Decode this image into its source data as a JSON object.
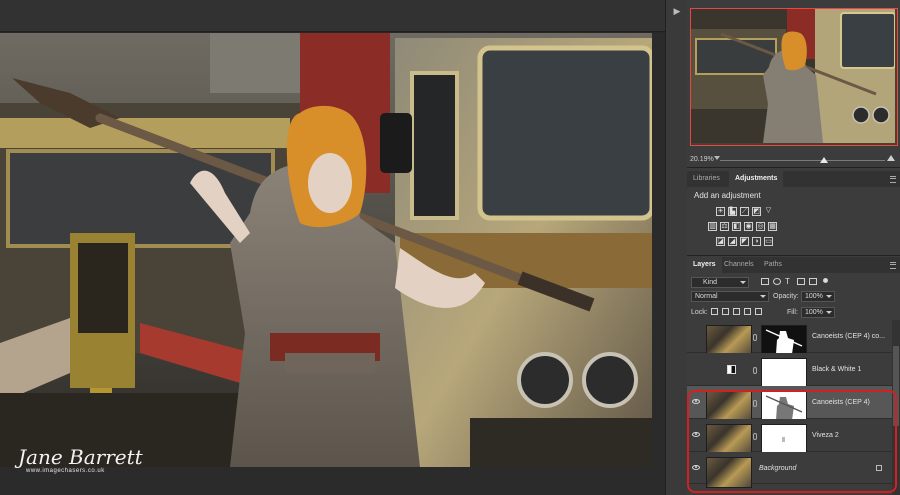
{
  "navigator": {
    "zoom": "20.19%"
  },
  "adjustments": {
    "tabs": [
      "Libraries",
      "Adjustments"
    ],
    "active_tab": "Adjustments",
    "heading": "Add an adjustment",
    "icons_row1": [
      "brightness-contrast-icon",
      "levels-icon",
      "curves-icon",
      "exposure-icon",
      "vibrance-icon"
    ],
    "icons_row2": [
      "hue-saturation-icon",
      "color-balance-icon",
      "black-white-icon",
      "photo-filter-icon",
      "channel-mixer-icon",
      "color-lookup-icon"
    ],
    "icons_row3": [
      "invert-icon",
      "posterize-icon",
      "threshold-icon",
      "selective-color-icon",
      "gradient-map-icon"
    ]
  },
  "layers_panel": {
    "tabs": [
      "Layers",
      "Channels",
      "Paths"
    ],
    "active_tab": "Layers",
    "filter_kind": "Kind",
    "blend_mode": "Normal",
    "opacity_label": "Opacity:",
    "opacity_value": "100%",
    "lock_label": "Lock:",
    "fill_label": "Fill:",
    "fill_value": "100%",
    "layers": [
      {
        "name": "Canoeists (CEP 4) co...",
        "visible": false,
        "mask": "black"
      },
      {
        "name": "Black & White 1",
        "visible": false,
        "mask": "white",
        "adjustment": true
      },
      {
        "name": "Canoeists (CEP 4)",
        "visible": true,
        "mask": "figure",
        "selected": true
      },
      {
        "name": "Viveza 2",
        "visible": true,
        "mask": "white"
      },
      {
        "name": "Background",
        "visible": true,
        "locked": true
      }
    ]
  },
  "watermark": {
    "name": "Jane Barrett",
    "url": "www.imagechasers.co.uk"
  },
  "colors": {
    "highlight": "#d32121",
    "panel_bg": "#3c3c3c",
    "nav_frame": "#e84545"
  }
}
